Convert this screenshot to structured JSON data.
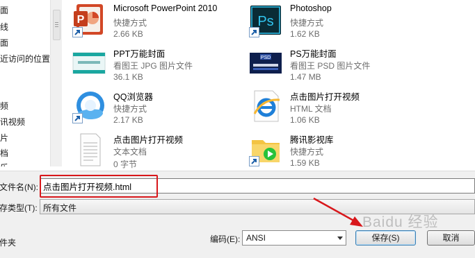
{
  "nav_items": [
    "面",
    "线",
    "面",
    "近访问的位置",
    "频",
    "讯视频",
    "片",
    "档",
    "乐"
  ],
  "files": [
    {
      "name": "Microsoft PowerPoint 2010",
      "type": "快捷方式",
      "size": "2.66 KB",
      "icon": "powerpoint-icon"
    },
    {
      "name": "Photoshop",
      "type": "快捷方式",
      "size": "1.62 KB",
      "icon": "photoshop-icon"
    },
    {
      "name": "PPT万能封面",
      "type": "看图王 JPG 图片文件",
      "size": "36.1 KB",
      "icon": "jpg-thumbnail-icon"
    },
    {
      "name": "PS万能封面",
      "type": "看图王 PSD 图片文件",
      "size": "1.47 MB",
      "icon": "psd-thumbnail-icon"
    },
    {
      "name": "QQ浏览器",
      "type": "快捷方式",
      "size": "2.17 KB",
      "icon": "qq-browser-icon"
    },
    {
      "name": "点击图片打开视频",
      "type": "HTML 文档",
      "size": "1.06 KB",
      "icon": "ie-html-icon"
    },
    {
      "name": "点击图片打开视频",
      "type": "文本文档",
      "size": "0 字节",
      "icon": "text-document-icon"
    },
    {
      "name": "腾讯影视库",
      "type": "快捷方式",
      "size": "1.59 KB",
      "icon": "tencent-video-icon"
    }
  ],
  "psd_thumb_label": "PSD",
  "filename_label": "文件名(N):",
  "filename_value": "点击图片打开视频.html",
  "filetype_label": "存类型(T):",
  "filetype_value": "所有文件",
  "hide_folders_label": "件夹",
  "encoding_label": "编码(E):",
  "encoding_value": "ANSI",
  "save_label": "保存(S)",
  "cancel_label": "取消",
  "watermark": "Baidu 经验",
  "colors": {
    "highlight": "#d8171b",
    "arrow": "#d8171b"
  }
}
